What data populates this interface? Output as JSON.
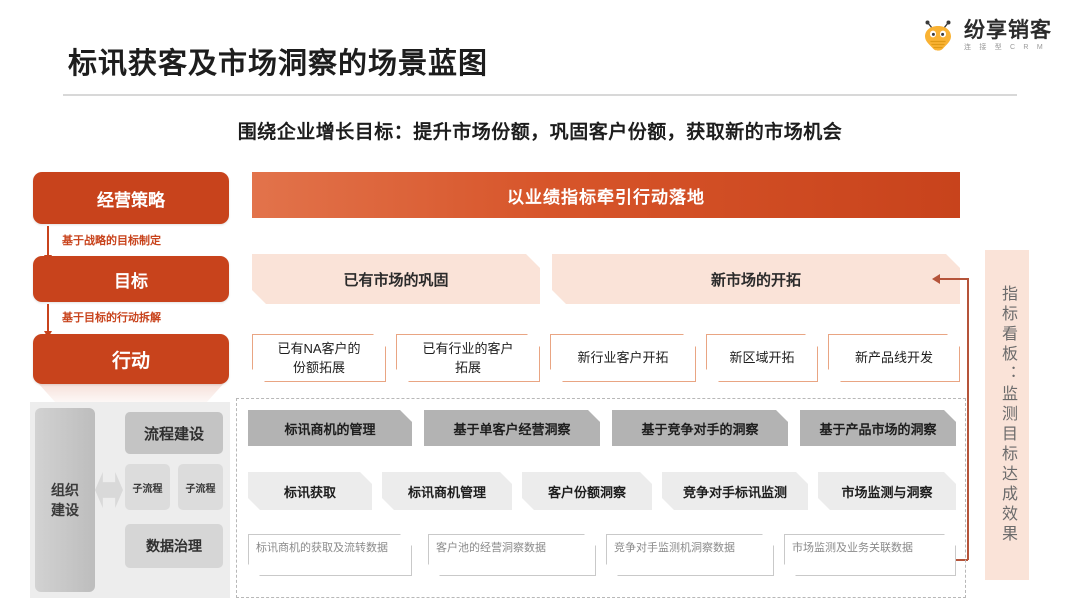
{
  "brand": {
    "logo_name": "纷享销客",
    "logo_tagline": "连 接 型 C R M",
    "logo_icon": "bee-mascot-icon"
  },
  "header": {
    "title": "标讯获客及市场洞察的场景蓝图",
    "subtitle": "围绕企业增长目标：提升市场份额，巩固客户份额，获取新的市场机会"
  },
  "strategy_column": {
    "boxes": [
      {
        "label": "经营策略"
      },
      {
        "label": "目标"
      },
      {
        "label": "行动"
      }
    ],
    "arrow_labels": [
      "基于战略的目标制定",
      "基于目标的行动拆解"
    ]
  },
  "banner": {
    "label": "以业绩指标牵引行动落地"
  },
  "markets": [
    {
      "label": "已有市场的巩固"
    },
    {
      "label": "新市场的开拓"
    }
  ],
  "actions": [
    {
      "label": "已有NA客户的\n份额拓展"
    },
    {
      "label": "已有行业的客户\n拓展"
    },
    {
      "label": "新行业客户开拓"
    },
    {
      "label": "新区域开拓"
    },
    {
      "label": "新产品线开发"
    }
  ],
  "kanban": {
    "label": "指标看板：监测目标达成效果"
  },
  "org": {
    "title": "组织\n建设",
    "process_main": "流程建设",
    "subprocesses": [
      "子流程",
      "子流程"
    ],
    "data_governance": "数据治理"
  },
  "capabilities": {
    "scenario_row": [
      {
        "label": "标讯商机的管理"
      },
      {
        "label": "基于单客户经营洞察"
      },
      {
        "label": "基于竞争对手的洞察"
      },
      {
        "label": "基于产品市场的洞察"
      }
    ],
    "function_row": [
      {
        "label": "标讯获取"
      },
      {
        "label": "标讯商机管理"
      },
      {
        "label": "客户份额洞察"
      },
      {
        "label": "竞争对手标讯监测"
      },
      {
        "label": "市场监测与洞察"
      }
    ],
    "data_row": [
      {
        "label": "标讯商机的获取及流转数据"
      },
      {
        "label": "客户池的经营洞察数据"
      },
      {
        "label": "竞争对手监测机洞察数据"
      },
      {
        "label": "市场监测及业务关联数据"
      }
    ]
  },
  "colors": {
    "primary_orange": "#c8431c",
    "banner_gradient_start": "#e2734b",
    "banner_gradient_end": "#c8431c",
    "peach": "#fae3d8",
    "action_outline": "#e9a583",
    "connector": "#b5543a",
    "grey_panel": "#ededed",
    "cap_dark": "#b3b3b3",
    "cap_light": "#ececec"
  }
}
